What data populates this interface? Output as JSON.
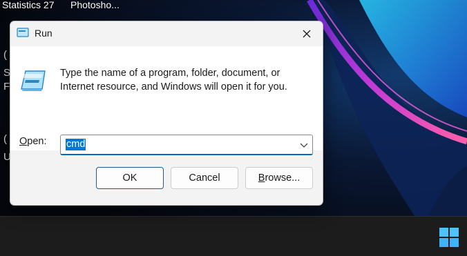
{
  "desktop": {
    "icon_labels": [
      "Statistics 27",
      "Photosho..."
    ],
    "edge_glyphs": [
      "(",
      "S",
      "F",
      "(",
      "U"
    ]
  },
  "dialog": {
    "title": "Run",
    "description": "Type the name of a program, folder, document, or Internet resource, and Windows will open it for you.",
    "open_label_underlined": "O",
    "open_label_rest": "pen:",
    "open_value": "cmd",
    "ok_label": "OK",
    "cancel_label": "Cancel",
    "browse_label_underlined": "B",
    "browse_label_rest": "rowse..."
  },
  "colors": {
    "accent": "#0078d4",
    "dialog_bg": "#f3f3f3",
    "content_bg": "#ffffff",
    "taskbar_bg": "#1c1c1c",
    "start_icon": "#4cc2ff"
  },
  "icons": {
    "title_icon": "run-icon",
    "close_icon": "close-icon",
    "dropdown_icon": "chevron-down-icon",
    "start_icon": "windows-logo-icon"
  }
}
